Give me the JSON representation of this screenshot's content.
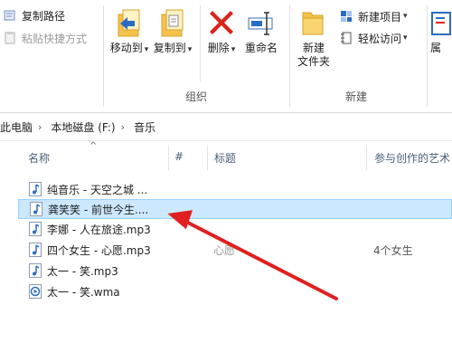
{
  "ribbon": {
    "copy_path": "复制路径",
    "paste_shortcut": "粘贴快捷方式",
    "move_to": "移动到",
    "copy_to": "复制到",
    "delete": "删除",
    "rename": "重命名",
    "new_folder_line1": "新建",
    "new_folder_line2": "文件夹",
    "new_item": "新建项目",
    "easy_access": "轻松访问",
    "prop_partial": "属",
    "group_organize": "组织",
    "group_new": "新建"
  },
  "address": {
    "crumbs": [
      "此电脑",
      "本地磁盘 (F:)",
      "音乐"
    ]
  },
  "columns": {
    "name": "名称",
    "number": "#",
    "title": "标题",
    "artist": "参与创作的艺术"
  },
  "files": [
    {
      "name": "纯音乐 - 天空之城 ...",
      "title": "",
      "artist": "",
      "type": "mp3"
    },
    {
      "name": "龚笑笑 - 前世今生....",
      "title": "",
      "artist": "",
      "type": "mp3"
    },
    {
      "name": "李娜 - 人在旅途.mp3",
      "title": "",
      "artist": "",
      "type": "mp3"
    },
    {
      "name": "四个女生 - 心愿.mp3",
      "title": "心愿",
      "artist": "4个女生",
      "type": "mp3"
    },
    {
      "name": "太一 - 笑.mp3",
      "title": "",
      "artist": "",
      "type": "mp3"
    },
    {
      "name": "太一 - 笑.wma",
      "title": "",
      "artist": "",
      "type": "wma"
    }
  ],
  "colors": {
    "selection_bg": "#cce8ff",
    "selection_border": "#99d1ff",
    "annotation_arrow": "#e02020",
    "folder_yellow": "#f5c34b",
    "delete_red": "#d9241c",
    "music_blue": "#2a6cc4"
  },
  "icons": {
    "audio_file": "music-note-icon",
    "wma_file": "media-player-icon"
  }
}
